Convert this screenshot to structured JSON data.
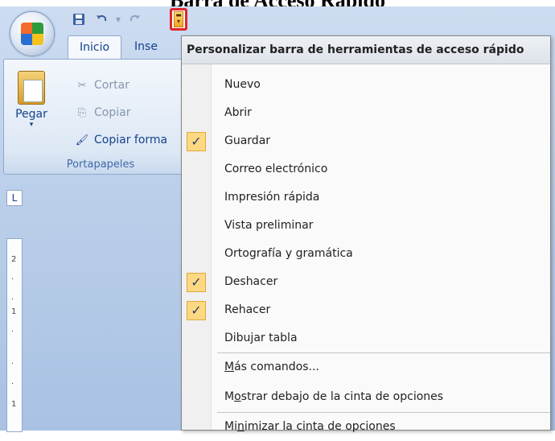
{
  "caption": "Barra de Acceso Rápido",
  "qat": {
    "save_icon": "floppy-disk-icon",
    "undo_icon": "undo-arrow-icon",
    "redo_icon": "redo-arrow-icon",
    "customize_icon": "dropdown-arrow-icon"
  },
  "tabs": [
    {
      "label": "Inicio",
      "active": true
    },
    {
      "label": "Inse",
      "active": false
    }
  ],
  "ribbon": {
    "paste_label": "Pegar",
    "cut_label": "Cortar",
    "copy_label": "Copiar",
    "format_painter_label": "Copiar forma",
    "group_label": "Portapapeles"
  },
  "ruler": {
    "corner": "L",
    "marks": [
      "2",
      "·",
      "·",
      "1",
      "·",
      "·",
      "·",
      "1"
    ]
  },
  "menu": {
    "title": "Personalizar barra de herramientas de acceso rápido",
    "items": [
      {
        "pre": "",
        "u": "",
        "post": "Nuevo",
        "checked": false
      },
      {
        "pre": "",
        "u": "",
        "post": "Abrir",
        "checked": false
      },
      {
        "pre": "",
        "u": "",
        "post": "Guardar",
        "checked": true
      },
      {
        "pre": "",
        "u": "",
        "post": "Correo electrónico",
        "checked": false
      },
      {
        "pre": "",
        "u": "",
        "post": "Impresión rápida",
        "checked": false
      },
      {
        "pre": "",
        "u": "",
        "post": "Vista preliminar",
        "checked": false
      },
      {
        "pre": "",
        "u": "",
        "post": "Ortografía y gramática",
        "checked": false
      },
      {
        "pre": "",
        "u": "",
        "post": "Deshacer",
        "checked": true
      },
      {
        "pre": "",
        "u": "",
        "post": "Rehacer",
        "checked": true
      },
      {
        "pre": "",
        "u": "",
        "post": "Dibujar tabla",
        "checked": false
      },
      {
        "pre": "",
        "u": "M",
        "post": "ás comandos...",
        "checked": false
      },
      {
        "pre": "M",
        "u": "o",
        "post": "strar debajo de la cinta de opciones",
        "checked": false
      },
      {
        "pre": "Mi",
        "u": "n",
        "post": "imizar la cinta de opciones",
        "checked": false
      }
    ],
    "check_glyph": "✓"
  }
}
